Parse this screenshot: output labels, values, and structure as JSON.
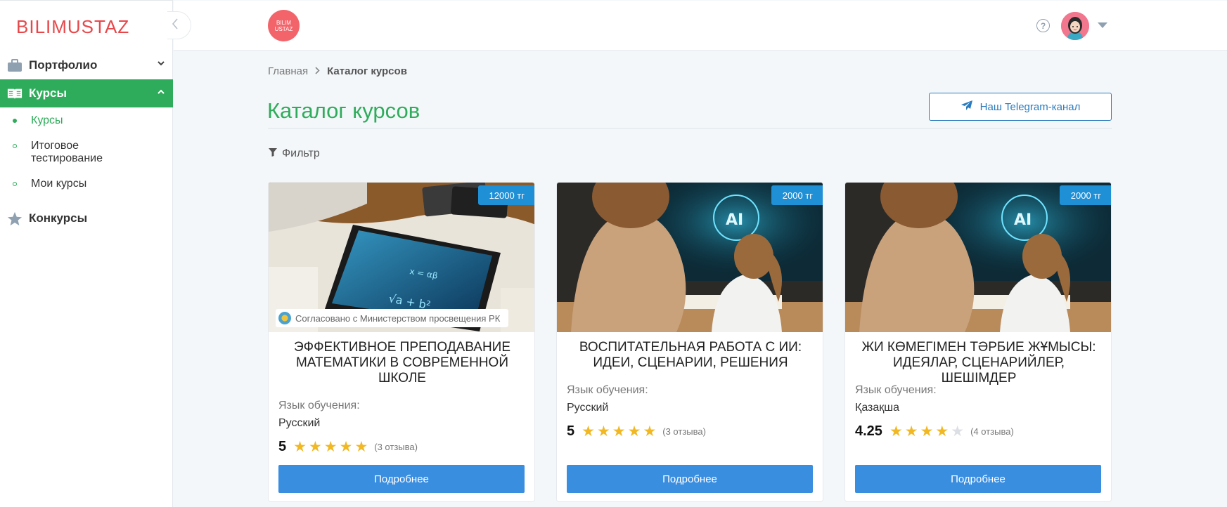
{
  "sidebar": {
    "logo": "BILIMUSTAZ",
    "items": [
      {
        "label": "Портфолио"
      },
      {
        "label": "Курсы"
      },
      {
        "label": "Конкурсы"
      }
    ],
    "sub_items": [
      {
        "label": "Курсы"
      },
      {
        "label": "Итоговое тестирование"
      },
      {
        "label": "Мои курсы"
      }
    ]
  },
  "header": {
    "badge_line1": "BILIM",
    "badge_line2": "USTAZ",
    "help": "?"
  },
  "breadcrumb": {
    "home": "Главная",
    "current": "Каталог курсов"
  },
  "page": {
    "title": "Каталог курсов",
    "telegram_label": "Наш Telegram-канал",
    "filter_label": "Фильтр"
  },
  "cards": [
    {
      "price": "12000 тг",
      "approved": "Согласовано с Министерством просвещения РК",
      "title": "ЭФФЕКТИВНОЕ ПРЕПОДАВАНИЕ МАТЕМАТИКИ В СОВРЕМЕННОЙ ШКОЛЕ",
      "lang_label": "Язык обучения:",
      "lang": "Русский",
      "rating": "5",
      "stars": 5,
      "reviews": "(3 отзыва)",
      "button": "Подробнее"
    },
    {
      "price": "2000 тг",
      "title": "ВОСПИТАТЕЛЬНАЯ РАБОТА С ИИ: ИДЕИ, СЦЕНАРИИ, РЕШЕНИЯ",
      "lang_label": "Язык обучения:",
      "lang": "Русский",
      "rating": "5",
      "stars": 5,
      "reviews": "(3 отзыва)",
      "button": "Подробнее",
      "image_text": "AI"
    },
    {
      "price": "2000 тг",
      "title": "ЖИ КӨМЕГІМЕН ТӘРБИЕ ЖҰМЫСЫ: ИДЕЯЛАР, СЦЕНАРИЙЛЕР, ШЕШІМДЕР",
      "lang_label": "Язык обучения:",
      "lang": "Қазақша",
      "rating": "4.25",
      "stars": 4,
      "reviews": "(4 отзыва)",
      "button": "Подробнее",
      "image_text": "AI"
    }
  ],
  "colors": {
    "brand_red": "#e8474a",
    "green": "#2fac5b",
    "blue": "#3a8ee0",
    "price_blue": "#1f8fd6",
    "star": "#f1b823"
  }
}
